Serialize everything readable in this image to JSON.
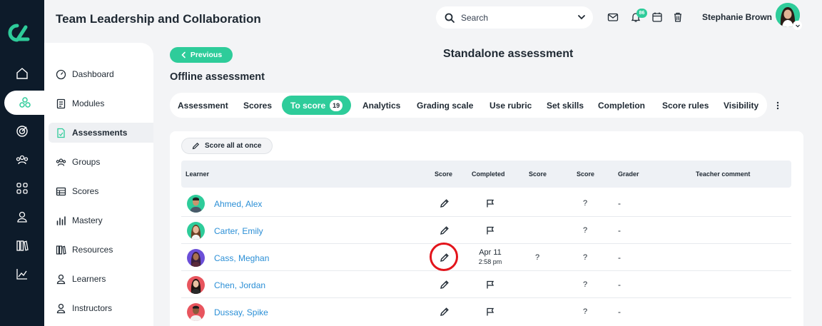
{
  "header": {
    "app_title": "Team Leadership and Collaboration",
    "search_placeholder": "Search",
    "notifications_count": "86",
    "user_name": "Stephanie Brown"
  },
  "rail": {
    "items": [
      {
        "icon": "home-icon"
      },
      {
        "icon": "sitemap-icon",
        "active": true
      },
      {
        "icon": "target-icon"
      },
      {
        "icon": "users-icon"
      },
      {
        "icon": "grid-icon"
      },
      {
        "icon": "person-icon"
      },
      {
        "icon": "library-icon"
      },
      {
        "icon": "line-chart-icon"
      }
    ]
  },
  "sidebar": {
    "items": [
      {
        "label": "Dashboard",
        "icon": "dashboard-icon"
      },
      {
        "label": "Modules",
        "icon": "modules-icon"
      },
      {
        "label": "Assessments",
        "icon": "assessments-icon",
        "active": true
      },
      {
        "label": "Groups",
        "icon": "groups-icon"
      },
      {
        "label": "Scores",
        "icon": "scores-icon"
      },
      {
        "label": "Mastery",
        "icon": "mastery-icon"
      },
      {
        "label": "Resources",
        "icon": "resources-icon"
      },
      {
        "label": "Learners",
        "icon": "learners-icon"
      },
      {
        "label": "Instructors",
        "icon": "instructors-icon"
      }
    ]
  },
  "page": {
    "previous_label": "Previous",
    "title": "Standalone assessment",
    "section_title": "Offline assessment"
  },
  "tabs": [
    {
      "label": "Assessment"
    },
    {
      "label": "Scores"
    },
    {
      "label": "To score",
      "count": "19",
      "active": true
    },
    {
      "label": "Analytics"
    },
    {
      "label": "Grading scale"
    },
    {
      "label": "Use rubric"
    },
    {
      "label": "Set skills"
    },
    {
      "label": "Completion"
    },
    {
      "label": "Score rules"
    },
    {
      "label": "Visibility"
    }
  ],
  "table": {
    "score_all_label": "Score all at once",
    "columns": [
      "Learner",
      "Score",
      "Completed",
      "Score",
      "Score",
      "Grader",
      "Teacher comment"
    ],
    "rows": [
      {
        "name": "Ahmed, Alex",
        "completed_date": "",
        "completed_time": "",
        "score2": "",
        "score3": "?",
        "grader": "-",
        "avatar_color": "#2ecc9a"
      },
      {
        "name": "Carter, Emily",
        "completed_date": "",
        "completed_time": "",
        "score2": "",
        "score3": "?",
        "grader": "-",
        "avatar_color": "#2ecc9a"
      },
      {
        "name": "Cass, Meghan",
        "completed_date": "Apr 11",
        "completed_time": "2:58 pm",
        "score2": "?",
        "score3": "?",
        "grader": "-",
        "avatar_color": "#6b4fd8"
      },
      {
        "name": "Chen, Jordan",
        "completed_date": "",
        "completed_time": "",
        "score2": "",
        "score3": "?",
        "grader": "-",
        "avatar_color": "#e8555e"
      },
      {
        "name": "Dussay, Spike",
        "completed_date": "",
        "completed_time": "",
        "score2": "",
        "score3": "?",
        "grader": "-",
        "avatar_color": "#e8555e"
      }
    ]
  },
  "colors": {
    "accent": "#2ecc9a",
    "rail_bg": "#0d1b2a",
    "link": "#2b8fd6",
    "highlight": "#e3141b"
  }
}
